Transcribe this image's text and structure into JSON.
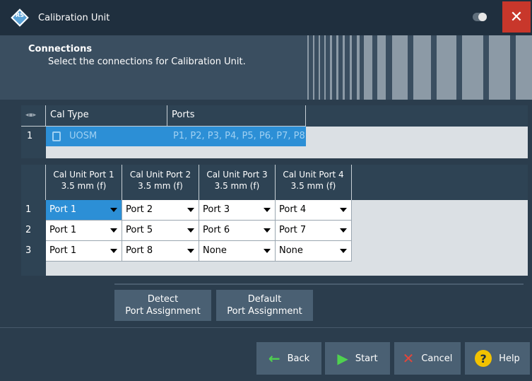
{
  "window": {
    "title": "Calibration Unit",
    "logo_text": "RS",
    "close_glyph": "✕"
  },
  "header": {
    "title": "Connections",
    "subtitle": "Select the connections for Calibration Unit."
  },
  "cal_type_table": {
    "columns": [
      "Cal Type",
      "Ports"
    ],
    "col_icon": "◂▪▸",
    "rows": [
      {
        "num": "1",
        "cal_type": "UOSM",
        "ports": "P1, P2, P3, P4, P5, P6, P7, P8"
      }
    ]
  },
  "port_table": {
    "columns": [
      {
        "line1": "Cal Unit Port 1",
        "line2": "3.5 mm (f)"
      },
      {
        "line1": "Cal Unit Port 2",
        "line2": "3.5 mm (f)"
      },
      {
        "line1": "Cal Unit Port 3",
        "line2": "3.5 mm (f)"
      },
      {
        "line1": "Cal Unit Port 4",
        "line2": "3.5 mm (f)"
      }
    ],
    "rows": [
      {
        "num": "1",
        "cells": [
          "Port 1",
          "Port 2",
          "Port 3",
          "Port 4"
        ]
      },
      {
        "num": "2",
        "cells": [
          "Port 1",
          "Port 5",
          "Port 6",
          "Port 7"
        ]
      },
      {
        "num": "3",
        "cells": [
          "Port 1",
          "Port 8",
          "None",
          "None"
        ]
      }
    ]
  },
  "actions": {
    "detect_line1": "Detect",
    "detect_line2": "Port Assignment",
    "default_line1": "Default",
    "default_line2": "Port Assignment"
  },
  "footer": {
    "back": "Back",
    "start": "Start",
    "cancel": "Cancel",
    "help": "Help"
  },
  "colors": {
    "accent": "#2c8fd6",
    "close": "#c8372b",
    "go": "#4fd14f",
    "cancel_icon": "#e3463a",
    "help_icon": "#f2c200"
  }
}
